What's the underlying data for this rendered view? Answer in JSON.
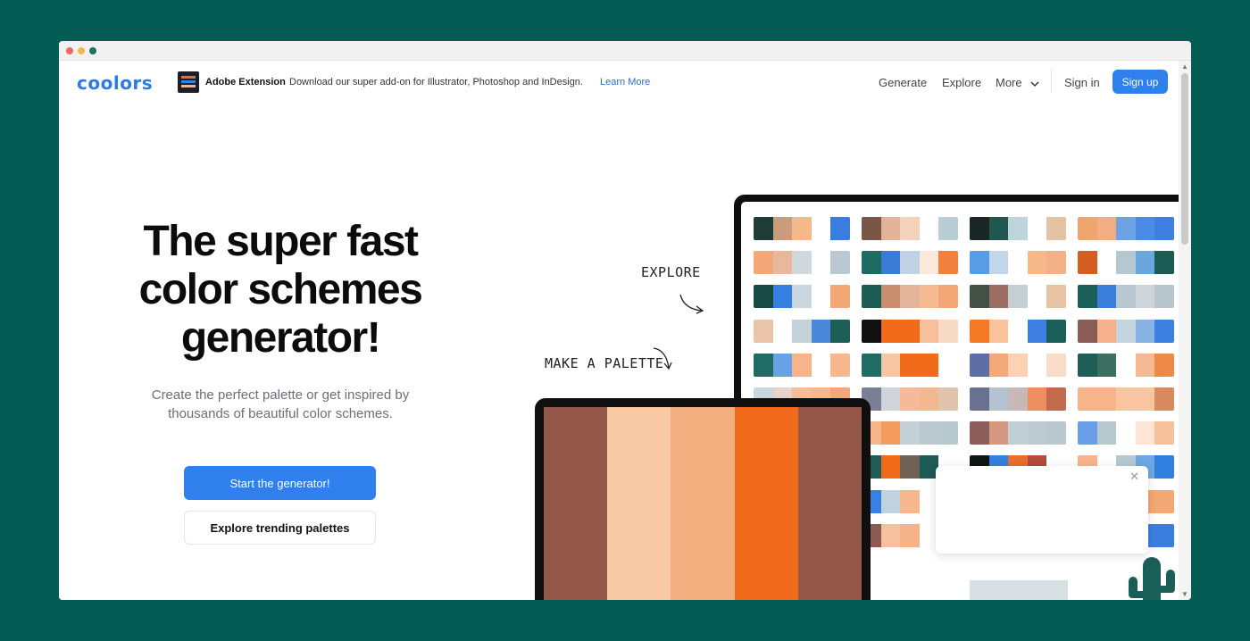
{
  "nav": {
    "logo": "coolors",
    "extension_title": "Adobe Extension",
    "extension_desc": "Download our super add-on for Illustrator, Photoshop and InDesign.",
    "extension_link": "Learn More",
    "links": [
      "Generate",
      "Explore",
      "More"
    ],
    "sign_in": "Sign in",
    "sign_up": "Sign up",
    "more_icon": "chevron-down-icon"
  },
  "hero": {
    "title_lines": [
      "The super fast",
      "color schemes",
      "generator!"
    ],
    "subtitle_lines": [
      "Create the perfect palette or get inspired by",
      "thousands of beautiful color schemes."
    ],
    "primary_button": "Start the generator!",
    "secondary_button": "Explore trending palettes"
  },
  "annotations": {
    "explore": "EXPLORE",
    "make_palette": "MAKE A PALETTE"
  },
  "laptop_palette": [
    "#935849",
    "#f7c9a5",
    "#f3ae80",
    "#f26a1b",
    "#935849"
  ],
  "monitor_palettes": [
    [
      [
        "#1f3c39",
        "#c99c7c",
        "#f6b98c",
        "#ffffff",
        "#3a7de0"
      ],
      [
        "#7a5647",
        "#e2b399",
        "#f5d2bb",
        "#ffffff",
        "#b8cdd4"
      ],
      [
        "#1b2725",
        "#21574f",
        "#bcd4da",
        "#ffffff",
        "#e3c3a4"
      ],
      [
        "#f0a56e",
        "#f2ad82",
        "#6fa2e3",
        "#4a8ce3",
        "#3c7fe0"
      ]
    ],
    [
      [
        "#f2a878",
        "#e8b89c",
        "#cfd8dd",
        "#ffffff",
        "#bac9d1"
      ],
      [
        "#1f6a63",
        "#3b7bd8",
        "#bfd1e3",
        "#fde8dc",
        "#f3813d"
      ],
      [
        "#5a9be6",
        "#c2d6ea",
        "#ffffff",
        "#f7b88a",
        "#f3b187"
      ],
      [
        "#d55e22",
        "#ffffff",
        "#b5c7d0",
        "#6aa7dc",
        "#1b5a55"
      ]
    ],
    [
      [
        "#1a4a45",
        "#3580e0",
        "#cad7de",
        "#ffffff",
        "#f3a878"
      ],
      [
        "#1d5b55",
        "#c98f70",
        "#e2b59a",
        "#f5bb90",
        "#f5a877"
      ],
      [
        "#425045",
        "#9b6d64",
        "#c3cfd3",
        "#ffffff",
        "#e8c4a6"
      ],
      [
        "#1a5f5a",
        "#3b7edc",
        "#b9c7d0",
        "#cfd6da",
        "#b7c5cc"
      ]
    ],
    [
      [
        "#e9c4a8",
        "#ffffff",
        "#c3d1d9",
        "#4b87d8",
        "#1f5d57"
      ],
      [
        "#111111",
        "#f26b1a",
        "#f26b1a",
        "#f7c09c",
        "#f7d9c4"
      ],
      [
        "#f47a25",
        "#f9c29a",
        "#ffffff",
        "#3c7fe0",
        "#1c5f58"
      ],
      [
        "#8a5c56",
        "#f6b08b",
        "#c3d4df",
        "#87b3e3",
        "#3d81e0"
      ]
    ],
    [
      [
        "#1f6b66",
        "#6aa0e6",
        "#f7b38a",
        "#ffffff",
        "#f6b88f"
      ],
      [
        "#1f6b66",
        "#f7c7a5",
        "#f26b1a",
        "#f26b1a",
        "#ffffff"
      ],
      [
        "#5f6fa6",
        "#f3a97a",
        "#fcd2b3",
        "#ffffff",
        "#f9ddc8"
      ],
      [
        "#1f5e57",
        "#3c6f60",
        "#ffffff",
        "#f6b996",
        "#ed8a4a"
      ]
    ],
    [
      [
        "#cbd7de",
        "#e6d4c8",
        "#f6bc95",
        "#f6b78e",
        "#f3a77a"
      ],
      [
        "#7b7f96",
        "#cfd5db",
        "#f7b998",
        "#f3b88f",
        "#e2c3ab"
      ],
      [
        "#6a7190",
        "#b5c2d0",
        "#c7b7b9",
        "#ed8f5e",
        "#c46a4c"
      ],
      [
        "#f6b488",
        "#f6b488",
        "#f9c5a1",
        "#f9c5a1",
        "#d88b5e"
      ]
    ],
    [
      [
        "#f3a96c",
        "#f6b88f",
        "#b9c7d0",
        "#ffffff",
        "#ffffff"
      ],
      [
        "#f7b38a",
        "#f39c5e",
        "#c3d0d8",
        "#bcc8d0",
        "#b8c8cf"
      ],
      [
        "#8c5e5c",
        "#d59880",
        "#c2ced5",
        "#bfcbd3",
        "#b9c7cf"
      ],
      [
        "#6a9ee8",
        "#b8c8cf",
        "#ffffff",
        "#fde5d5",
        "#f5c09a"
      ]
    ],
    [
      [
        "#3581e2",
        "#ee8a3b",
        "#f26b1a",
        "#f2ad87",
        "#ffffff"
      ],
      [
        "#1f5c57",
        "#f26b1a",
        "#6f6156",
        "#1b5a55",
        "#ffffff"
      ],
      [
        "#0f1515",
        "#3580e0",
        "#e86e2c",
        "#b24c3c",
        "#ffffff"
      ],
      [
        "#f6b38c",
        "#ffffff",
        "#b5c7d3",
        "#6ea7e1",
        "#3180e0"
      ]
    ],
    [
      [
        "#f6b993",
        "#ffffff",
        "#f4a67a",
        "#ffffff",
        "#f4a57b"
      ],
      [
        "#3a80e3",
        "#bfd2e0",
        "#f7b78c",
        "#ffffff",
        "#ffffff"
      ],
      [
        "#ffffff",
        "#ffffff",
        "#ffffff",
        "#ffffff",
        "#ffffff"
      ],
      [
        "#ffffff",
        "#ffffff",
        "#ffffff",
        "#f3a873",
        "#f3a873"
      ]
    ],
    [
      [
        "#d1b8a6",
        "#f6b88f",
        "#ffffff",
        "#ffffff",
        "#ffffff"
      ],
      [
        "#8c5a50",
        "#f7c0a0",
        "#f6b38a",
        "#ffffff",
        "#ffffff"
      ],
      [
        "#ffffff",
        "#ffffff",
        "#ffffff",
        "#ffffff",
        "#ffffff"
      ],
      [
        "#ffffff",
        "#ffffff",
        "#ffffff",
        "#3a7fe0",
        "#3a7fe0"
      ]
    ]
  ]
}
